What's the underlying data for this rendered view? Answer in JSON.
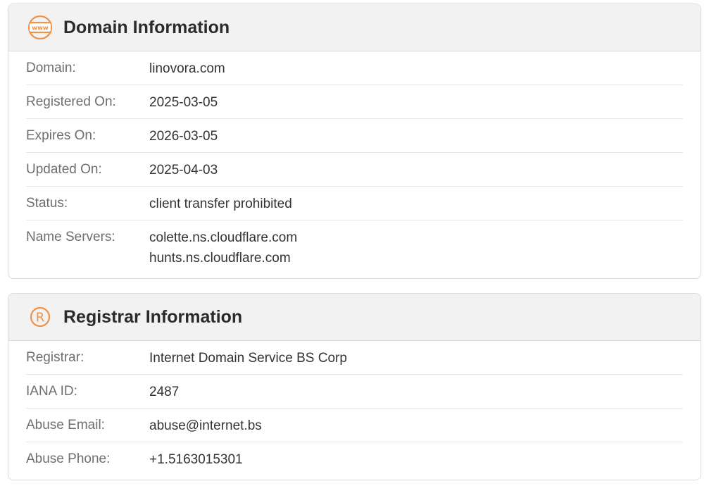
{
  "domain_card": {
    "title": "Domain Information",
    "icon": "www-globe-icon",
    "rows": [
      {
        "label": "Domain:",
        "value": "linovora.com"
      },
      {
        "label": "Registered On:",
        "value": "2025-03-05"
      },
      {
        "label": "Expires On:",
        "value": "2026-03-05"
      },
      {
        "label": "Updated On:",
        "value": "2025-04-03"
      },
      {
        "label": "Status:",
        "value": "client transfer prohibited"
      }
    ],
    "name_servers": {
      "label": "Name Servers:",
      "values": [
        "colette.ns.cloudflare.com",
        "hunts.ns.cloudflare.com"
      ]
    }
  },
  "registrar_card": {
    "title": "Registrar Information",
    "icon": "registered-icon",
    "icon_glyph": "R",
    "rows": [
      {
        "label": "Registrar:",
        "value": "Internet Domain Service BS Corp"
      },
      {
        "label": "IANA ID:",
        "value": "2487"
      },
      {
        "label": "Abuse Email:",
        "value": "abuse@internet.bs"
      },
      {
        "label": "Abuse Phone:",
        "value": "+1.5163015301"
      }
    ]
  },
  "colors": {
    "accent": "#f0924a",
    "header_bg": "#f2f2f2",
    "label": "#6e6e6e",
    "value": "#333333"
  }
}
